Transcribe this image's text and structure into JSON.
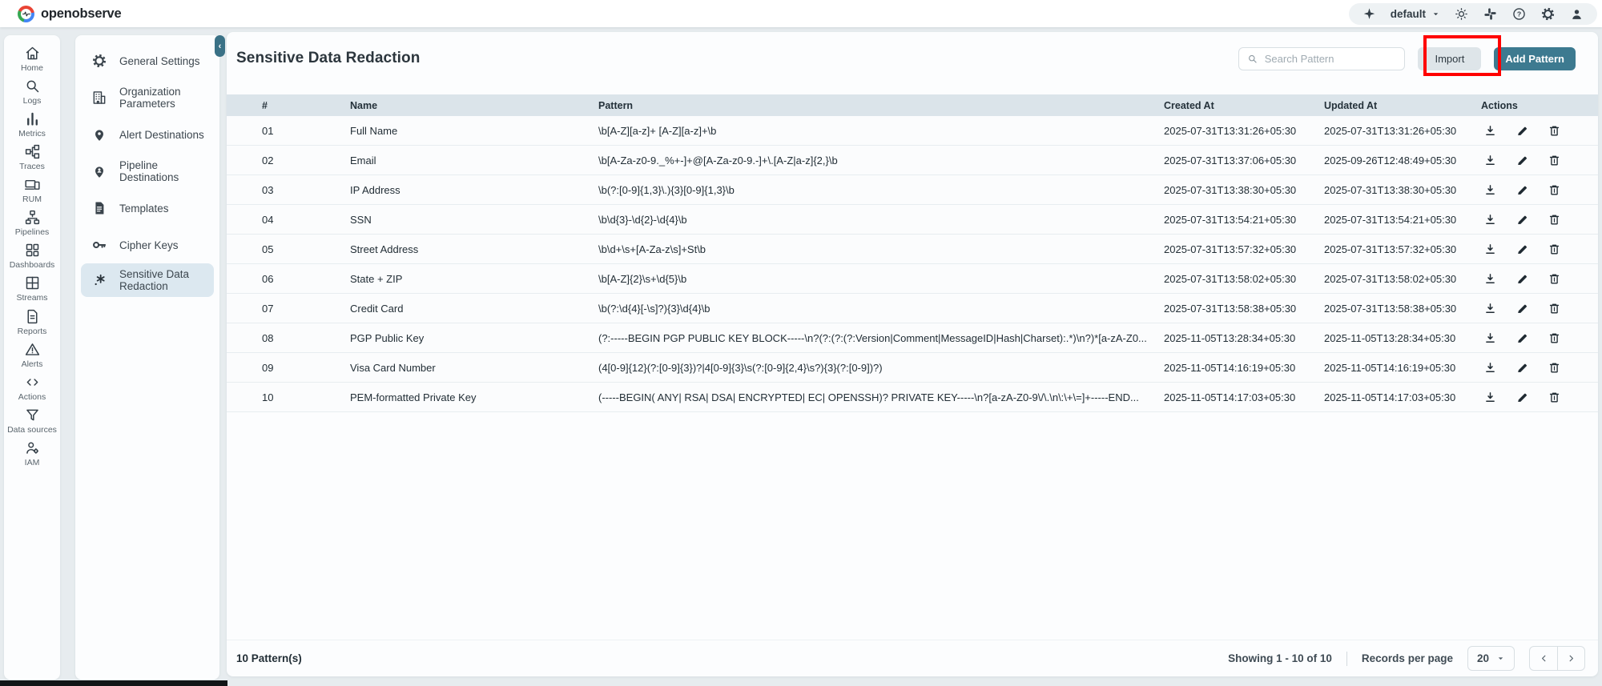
{
  "app": {
    "name": "openobserve"
  },
  "topbar": {
    "org_selector": "default",
    "icons": [
      "ai-sparkle",
      "theme-toggle",
      "slack",
      "help",
      "settings",
      "profile"
    ]
  },
  "sidebar": {
    "items": [
      {
        "label": "Home"
      },
      {
        "label": "Logs"
      },
      {
        "label": "Metrics"
      },
      {
        "label": "Traces"
      },
      {
        "label": "RUM"
      },
      {
        "label": "Pipelines"
      },
      {
        "label": "Dashboards"
      },
      {
        "label": "Streams"
      },
      {
        "label": "Reports"
      },
      {
        "label": "Alerts"
      },
      {
        "label": "Actions"
      },
      {
        "label": "Data sources"
      },
      {
        "label": "IAM"
      }
    ]
  },
  "settings_menu": {
    "items": [
      {
        "label": "General Settings"
      },
      {
        "label": "Organization Parameters"
      },
      {
        "label": "Alert Destinations"
      },
      {
        "label": "Pipeline Destinations"
      },
      {
        "label": "Templates"
      },
      {
        "label": "Cipher Keys"
      },
      {
        "label": "Sensitive Data Redaction",
        "selected": true
      }
    ]
  },
  "main": {
    "title": "Sensitive Data Redaction",
    "search_placeholder": "Search Pattern",
    "import_label": "Import",
    "add_pattern_label": "Add Pattern",
    "table": {
      "columns": [
        "#",
        "Name",
        "Pattern",
        "Created At",
        "Updated At",
        "Actions"
      ],
      "row_actions": [
        "download",
        "edit",
        "delete"
      ],
      "rows": [
        {
          "num": "01",
          "name": "Full Name",
          "pattern": "\\b[A-Z][a-z]+ [A-Z][a-z]+\\b",
          "created": "2025-07-31T13:31:26+05:30",
          "updated": "2025-07-31T13:31:26+05:30"
        },
        {
          "num": "02",
          "name": "Email",
          "pattern": "\\b[A-Za-z0-9._%+-]+@[A-Za-z0-9.-]+\\.[A-Z|a-z]{2,}\\b",
          "created": "2025-07-31T13:37:06+05:30",
          "updated": "2025-09-26T12:48:49+05:30"
        },
        {
          "num": "03",
          "name": "IP Address",
          "pattern": "\\b(?:[0-9]{1,3}\\.){3}[0-9]{1,3}\\b",
          "created": "2025-07-31T13:38:30+05:30",
          "updated": "2025-07-31T13:38:30+05:30"
        },
        {
          "num": "04",
          "name": "SSN",
          "pattern": "\\b\\d{3}-\\d{2}-\\d{4}\\b",
          "created": "2025-07-31T13:54:21+05:30",
          "updated": "2025-07-31T13:54:21+05:30"
        },
        {
          "num": "05",
          "name": "Street Address",
          "pattern": "\\b\\d+\\s+[A-Za-z\\s]+St\\b",
          "created": "2025-07-31T13:57:32+05:30",
          "updated": "2025-07-31T13:57:32+05:30"
        },
        {
          "num": "06",
          "name": "State + ZIP",
          "pattern": "\\b[A-Z]{2}\\s+\\d{5}\\b",
          "created": "2025-07-31T13:58:02+05:30",
          "updated": "2025-07-31T13:58:02+05:30"
        },
        {
          "num": "07",
          "name": "Credit Card",
          "pattern": "\\b(?:\\d{4}[-\\s]?){3}\\d{4}\\b",
          "created": "2025-07-31T13:58:38+05:30",
          "updated": "2025-07-31T13:58:38+05:30"
        },
        {
          "num": "08",
          "name": "PGP Public Key",
          "pattern": "(?:-----BEGIN PGP PUBLIC KEY BLOCK-----\\n?(?:(?:(?:Version|Comment|MessageID|Hash|Charset):.*)\\n?)*[a-zA-Z0...",
          "created": "2025-11-05T13:28:34+05:30",
          "updated": "2025-11-05T13:28:34+05:30"
        },
        {
          "num": "09",
          "name": "Visa Card Number",
          "pattern": "(4[0-9]{12}(?:[0-9]{3})?|4[0-9]{3}\\s(?:[0-9]{2,4}\\s?){3}(?:[0-9])?)",
          "created": "2025-11-05T14:16:19+05:30",
          "updated": "2025-11-05T14:16:19+05:30"
        },
        {
          "num": "10",
          "name": "PEM-formatted Private Key",
          "pattern": "(-----BEGIN( ANY| RSA| DSA| ENCRYPTED| EC| OPENSSH)? PRIVATE KEY-----\\n?[a-zA-Z0-9\\/\\.\\n\\:\\+\\=]+-----END...",
          "created": "2025-11-05T14:17:03+05:30",
          "updated": "2025-11-05T14:17:03+05:30"
        }
      ]
    },
    "footer": {
      "count": "10 Pattern(s)",
      "showing": "Showing 1 - 10 of 10",
      "records_per_page": "Records per page",
      "page_size": "20"
    }
  },
  "colors": {
    "accent_teal": "#3D7A90",
    "annotation_red": "#FF0000",
    "table_header_bg": "#DBE4EA",
    "selected_item_bg": "#DCE8F0",
    "page_bg": "#E7ECEF"
  }
}
